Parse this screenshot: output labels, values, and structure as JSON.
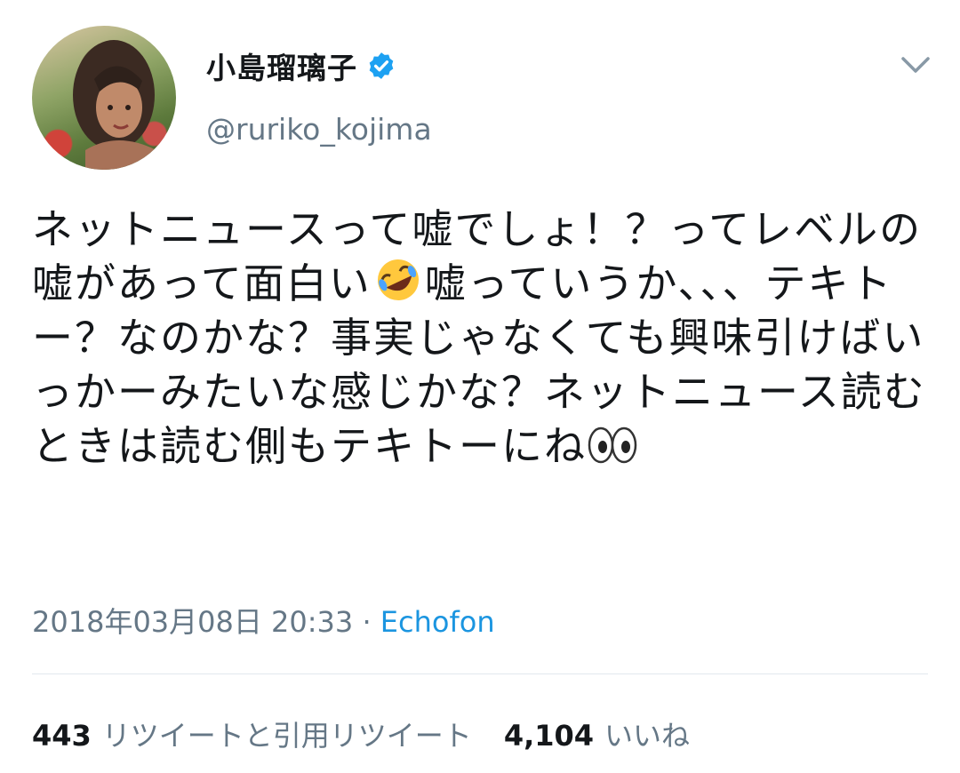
{
  "profile": {
    "display_name": "小島瑠璃子",
    "handle": "@ruriko_kojima",
    "verified_icon": "verified-badge-icon",
    "accent": "#1da1f2"
  },
  "tweet": {
    "text_before_emoji": "ネットニュースって嘘でしょ！？ってレベルの嘘があって面白い",
    "emoji_1": "rolling-on-floor-laughing-emoji",
    "text_middle": "嘘っていうか、、、テキトー？なのかな？事実じゃなくても興味引けばいっかーみたいな感じかな？ネットニュース読むときは読む側もテキトーにね",
    "emoji_2": "eyes-emoji"
  },
  "meta": {
    "timestamp": "2018年03月08日 20:33",
    "separator": " · ",
    "source": "Echofon",
    "source_color": "#1b95e0"
  },
  "stats": {
    "retweets_count": "443",
    "retweets_label": "リツイートと引用リツイート",
    "likes_count": "4,104",
    "likes_label": "いいね"
  }
}
